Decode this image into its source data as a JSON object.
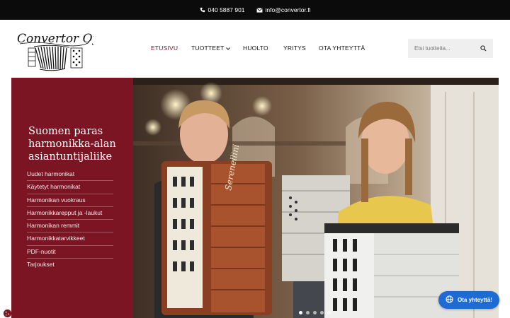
{
  "topbar": {
    "phone": "040 5887 901",
    "email": "info@convertor.fi"
  },
  "logo": {
    "text": "Convertor Oy"
  },
  "nav": {
    "items": [
      {
        "label": "ETUSIVU",
        "active": true
      },
      {
        "label": "TUOTTEET",
        "dropdown": true
      },
      {
        "label": "HUOLTO"
      },
      {
        "label": "YRITYS"
      },
      {
        "label": "OTA YHTEYTTÄ"
      }
    ]
  },
  "search": {
    "placeholder": "Etsi tuotteita..."
  },
  "hero": {
    "heading": "Suomen paras harmonikka-alan asiantuntijaliike",
    "menu": [
      "Uudet harmonikat",
      "Käytetyt harmonikat",
      "Harmonikan vuokraus",
      "Harmonikkarepput ja -laukut",
      "Harmonikan remmit",
      "Harmonikkatarvikkeet",
      "PDF-nuotit",
      "Tarjoukset"
    ],
    "accordion_brand": "Serenellini",
    "slider_dots": 5,
    "active_dot": 1
  },
  "chat": {
    "label": "Ota yhteyttä!"
  },
  "colors": {
    "brand": "#7b1523",
    "topbar": "#0b0b0b",
    "chat": "#1f6bd4"
  }
}
